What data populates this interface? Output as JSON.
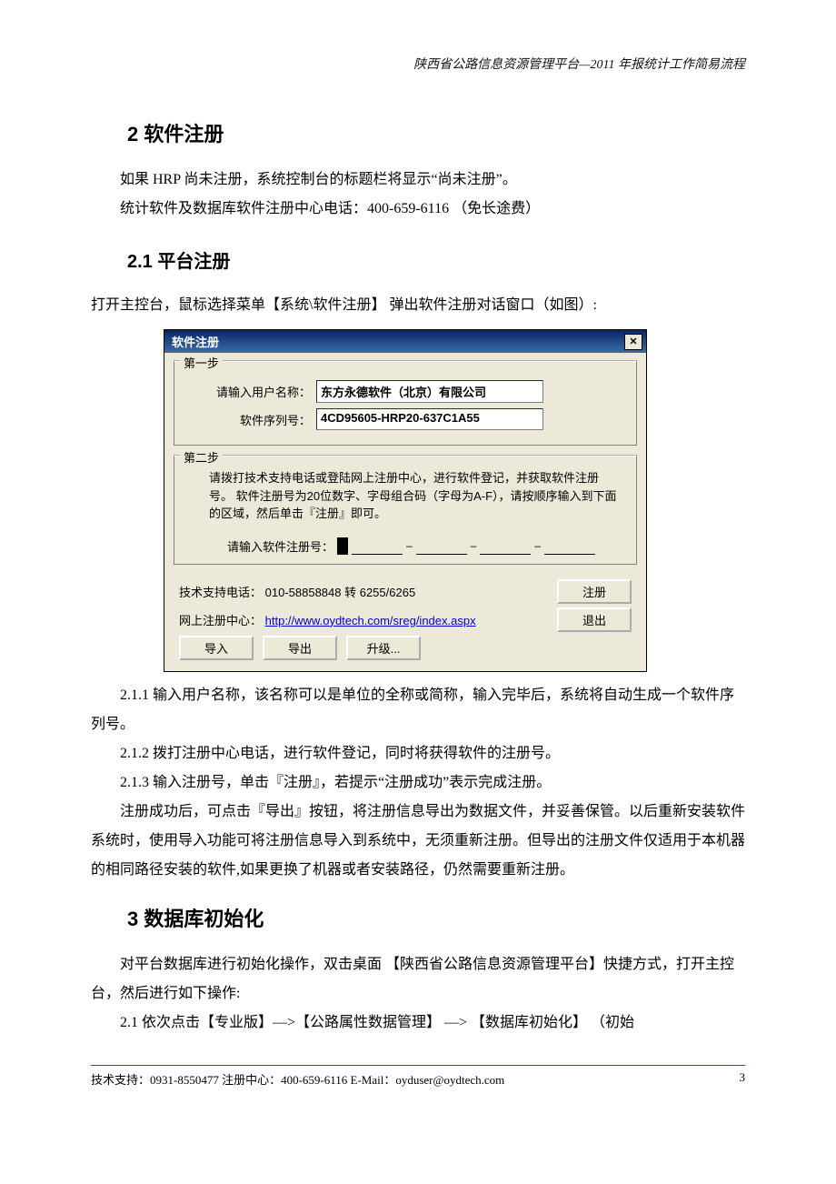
{
  "header": "陕西省公路信息资源管理平台—2011 年报统计工作简易流程",
  "sec2_title": "2 软件注册",
  "p1": "如果 HRP 尚未注册，系统控制台的标题栏将显示“尚未注册”。",
  "p2": "统计软件及数据库软件注册中心电话：400-659-6116 （免长途费）",
  "sec21_title": "2.1 平台注册",
  "p3": "打开主控台，鼠标选择菜单【系统\\软件注册】 弹出软件注册对话窗口（如图）:",
  "dialog": {
    "title": "软件注册",
    "close": "✕",
    "step1": {
      "legend": "第一步",
      "lbl_user": "请输入用户名称：",
      "val_user": "东方永德软件（北京）有限公司",
      "lbl_serial": "软件序列号：",
      "val_serial": "4CD95605-HRP20-637C1A55"
    },
    "step2": {
      "legend": "第二步",
      "text": "请拨打技术支持电话或登陆网上注册中心，进行软件登记，并获取软件注册号。 软件注册号为20位数字、字母组合码（字母为A-F），请按顺序输入到下面的区域，然后单击『注册』即可。",
      "lbl_regno": "请输入软件注册号："
    },
    "tech_label": "技术支持电话：",
    "tech_val": "010-58858848 转 6255/6265",
    "web_label": "网上注册中心：",
    "web_link": "http://www.oydtech.com/sreg/index.aspx",
    "btn_import": "导入",
    "btn_export": "导出",
    "btn_upgrade": "升级...",
    "btn_register": "注册",
    "btn_exit": "退出"
  },
  "p211": "2.1.1 输入用户名称，该名称可以是单位的全称或简称，输入完毕后，系统将自动生成一个软件序列号。",
  "p212": "2.1.2 拨打注册中心电话，进行软件登记，同时将获得软件的注册号。",
  "p213": "2.1.3 输入注册号，单击『注册』，若提示“注册成功”表示完成注册。",
  "p4": "注册成功后，可点击『导出』按钮，将注册信息导出为数据文件，并妥善保管。以后重新安装软件系统时，使用导入功能可将注册信息导入到系统中，无须重新注册。但导出的注册文件仅适用于本机器的相同路径安装的软件,如果更换了机器或者安装路径，仍然需要重新注册。",
  "sec3_title": "3 数据库初始化",
  "p5": "对平台数据库进行初始化操作，双击桌面 【陕西省公路信息资源管理平台】快捷方式，打开主控台，然后进行如下操作:",
  "p6": "2.1 依次点击【专业版】—>【公路属性数据管理】 —> 【数据库初始化】 （初始",
  "footer_left": "技术支持：0931-8550477  注册中心：400-659-6116  E-Mail：oyduser@oydtech.com",
  "footer_right": "3"
}
